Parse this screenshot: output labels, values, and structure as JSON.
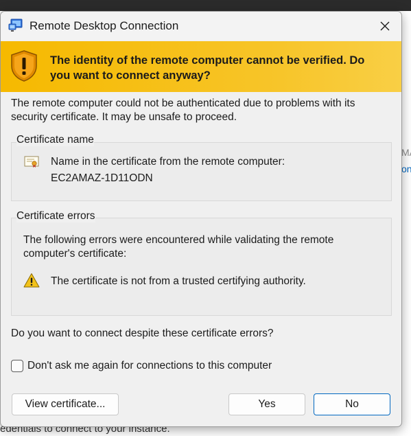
{
  "background": {
    "fragment_1": "MA",
    "fragment_2": "on",
    "fragment_3": "edentials to connect to your instance."
  },
  "window": {
    "title": "Remote Desktop Connection",
    "app_icon": "remote-desktop-icon",
    "close_icon": "close-icon"
  },
  "banner": {
    "icon": "security-shield-icon",
    "message": "The identity of the remote computer cannot be verified. Do you want to connect anyway?",
    "color": "#f6b900"
  },
  "description": "The remote computer could not be authenticated due to problems with its security certificate. It may be unsafe to proceed.",
  "certificate_name": {
    "heading": "Certificate name",
    "icon": "certificate-icon",
    "label": "Name in the certificate from the remote computer:",
    "value": "EC2AMAZ-1D11ODN"
  },
  "certificate_errors": {
    "heading": "Certificate errors",
    "intro": "The following errors were encountered while validating the remote computer's certificate:",
    "items": [
      {
        "icon": "warning-icon",
        "text": "The certificate is not from a trusted certifying authority."
      }
    ]
  },
  "question": "Do you want to connect despite these certificate errors?",
  "dont_ask_checkbox": {
    "label": "Don't ask me again for connections to this computer",
    "checked": false
  },
  "buttons": {
    "view_certificate": "View certificate...",
    "yes": "Yes",
    "no": "No",
    "default_accent": "#0067c0"
  }
}
